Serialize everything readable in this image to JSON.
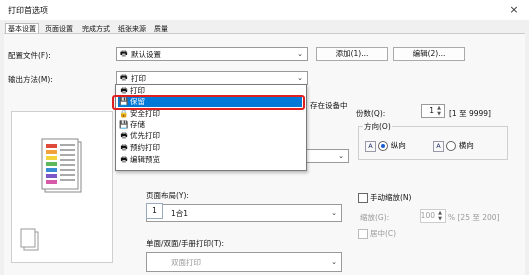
{
  "window": {
    "title": "打印首选项",
    "close_icon": "×"
  },
  "tabs": [
    "基本设置",
    "页面设置",
    "完成方式",
    "纸张来源",
    "质量"
  ],
  "profile": {
    "label": "配置文件(F):",
    "value": "默认设置",
    "add_label": "添加(1)...",
    "edit_label": "编辑(2)..."
  },
  "output": {
    "label": "输出方法(M):",
    "value": "打印",
    "behind_text": "存在设备中"
  },
  "dropdown": {
    "items": [
      {
        "icon": "🖶",
        "label": "打印",
        "selected": false
      },
      {
        "icon": "💾",
        "label": "保留",
        "selected": true
      },
      {
        "icon": "🔒",
        "label": "安全打印",
        "selected": false
      },
      {
        "icon": "💾",
        "label": "存储",
        "selected": false
      },
      {
        "icon": "🖶",
        "label": "优先打印",
        "selected": false
      },
      {
        "icon": "🖶",
        "label": "预约打印",
        "selected": false
      },
      {
        "icon": "🖶",
        "label": "编辑预览",
        "selected": false
      }
    ]
  },
  "copies": {
    "label": "份数(Q):",
    "value": "1",
    "range": "[1 至 9999]"
  },
  "orientation": {
    "label": "方向(O)",
    "portrait": "纵向",
    "landscape": "横向",
    "portrait_icon": "A",
    "landscape_icon": "A"
  },
  "page_layout": {
    "label": "页面布局(Y):",
    "value": "1合1",
    "icon_value": "1"
  },
  "manual_scaling": {
    "label": "手动缩放(N)",
    "scale_label": "缩放(G):",
    "scale_value": "100",
    "scale_range": "% [25 至 200]",
    "center_label": "居中(C)"
  },
  "duplex": {
    "label": "单面/双面/手册打印(T):",
    "value": "双面打印"
  }
}
